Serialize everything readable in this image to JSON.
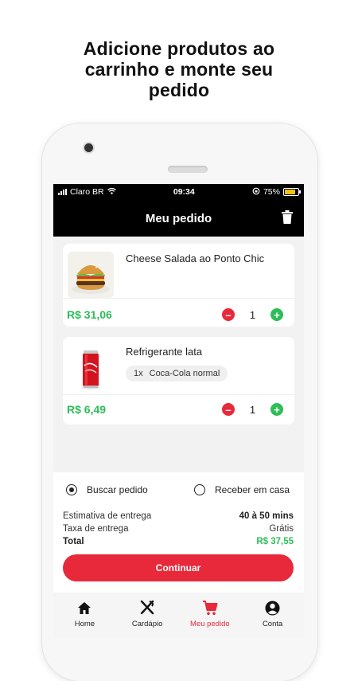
{
  "headline": {
    "line1": "Adicione produtos ao",
    "line2": "carrinho e monte seu",
    "line3": "pedido"
  },
  "status_bar": {
    "carrier": "Claro BR",
    "time": "09:34",
    "battery": "75%"
  },
  "header": {
    "title": "Meu pedido",
    "trash_icon": "trash-icon"
  },
  "items": [
    {
      "name": "Cheese Salada ao Ponto Chic",
      "price": "R$ 31,06",
      "quantity": "1",
      "image_icon": "burger-image"
    },
    {
      "name": "Refrigerante lata",
      "option_qty": "1x",
      "option_name": "Coca-Cola normal",
      "price": "R$ 6,49",
      "quantity": "1",
      "image_icon": "soda-can-image"
    }
  ],
  "delivery": {
    "option_pickup": "Buscar pedido",
    "option_home": "Receber em casa",
    "selected": "Buscar pedido",
    "estimate_label": "Estimativa de entrega",
    "estimate_value": "40 à 50 mins",
    "fee_label": "Taxa de entrega",
    "fee_value": "Grátis",
    "total_label": "Total",
    "total_value": "R$ 37,55"
  },
  "cta": {
    "label": "Continuar"
  },
  "tabbar": {
    "items": [
      {
        "label": "Home",
        "icon": "home-icon"
      },
      {
        "label": "Cardápio",
        "icon": "utensils-icon"
      },
      {
        "label": "Meu pedido",
        "icon": "cart-icon",
        "active": true
      },
      {
        "label": "Conta",
        "icon": "user-icon"
      }
    ]
  },
  "colors": {
    "accent_red": "#e8283b",
    "price_green": "#2ebd59",
    "header_black": "#000000"
  }
}
